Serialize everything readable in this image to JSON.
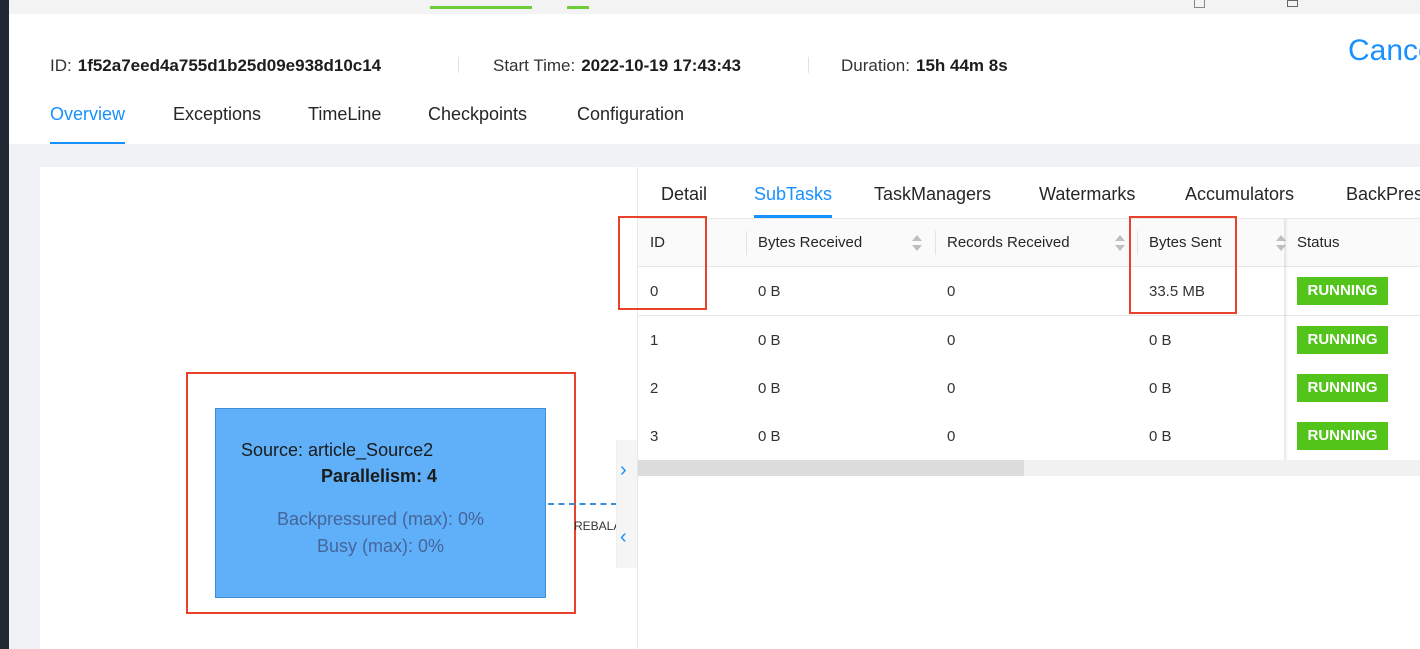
{
  "job": {
    "id_label": "ID:",
    "id_value": "1f52a7eed4a755d1b25d09e938d10c14",
    "start_label": "Start Time:",
    "start_value": "2022-10-19 17:43:43",
    "duration_label": "Duration:",
    "duration_value": "15h 44m 8s",
    "cancel_label": "Cancel"
  },
  "main_tabs": [
    "Overview",
    "Exceptions",
    "TimeLine",
    "Checkpoints",
    "Configuration"
  ],
  "graph": {
    "node": {
      "title": "Source: article_Source2",
      "parallelism": "Parallelism: 4",
      "backpressured": "Backpressured (max): 0%",
      "busy": "Busy (max): 0%"
    },
    "edge_label": "REBALANCE"
  },
  "sub_tabs": [
    "Detail",
    "SubTasks",
    "TaskManagers",
    "Watermarks",
    "Accumulators",
    "BackPressure"
  ],
  "table": {
    "columns": [
      "ID",
      "Bytes Received",
      "Records Received",
      "Bytes Sent",
      "Status"
    ],
    "rows": [
      {
        "id": "0",
        "bytes_received": "0 B",
        "records_received": "0",
        "bytes_sent": "33.5 MB",
        "status": "RUNNING"
      },
      {
        "id": "1",
        "bytes_received": "0 B",
        "records_received": "0",
        "bytes_sent": "0 B",
        "status": "RUNNING"
      },
      {
        "id": "2",
        "bytes_received": "0 B",
        "records_received": "0",
        "bytes_sent": "0 B",
        "status": "RUNNING"
      },
      {
        "id": "3",
        "bytes_received": "0 B",
        "records_received": "0",
        "bytes_sent": "0 B",
        "status": "RUNNING"
      }
    ]
  },
  "icons": {
    "expand": "›",
    "collapse": "‹"
  },
  "colors": {
    "accent": "#1890ff",
    "node_fill": "#5fb0f9",
    "running": "#52c41a",
    "highlight": "#e8412c"
  }
}
